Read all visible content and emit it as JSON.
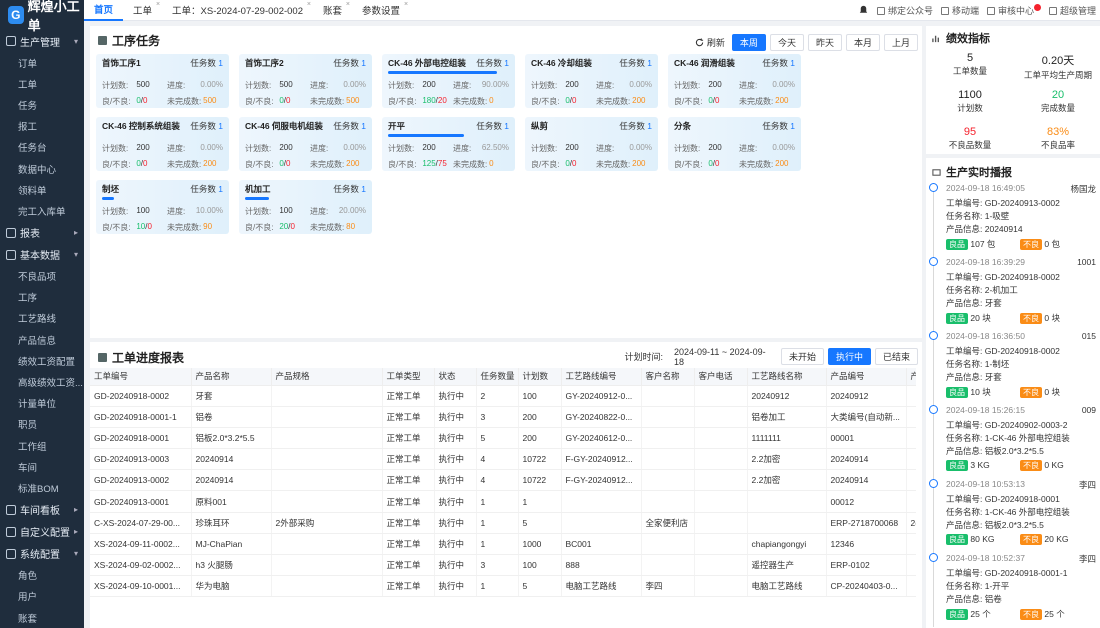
{
  "app": {
    "logo": "辉煌小工单",
    "logo_mark": "G"
  },
  "sidebar": {
    "groups": [
      {
        "label": "生产管理",
        "items": [
          "订单",
          "工单",
          "任务",
          "报工",
          "任务台",
          "数据中心",
          "领料单",
          "完工入库单"
        ]
      },
      {
        "label": "报表",
        "items": []
      },
      {
        "label": "基本数据",
        "items": [
          "不良品项",
          "工序",
          "工艺路线",
          "产品信息",
          "绩效工资配置",
          "高级绩效工资...",
          "计量单位",
          "职员",
          "工作组",
          "车间",
          "标准BOM"
        ]
      },
      {
        "label": "车间看板",
        "items": []
      },
      {
        "label": "自定义配置",
        "items": []
      },
      {
        "label": "系统配置",
        "items": [
          "角色",
          "用户",
          "账套"
        ]
      }
    ]
  },
  "tabs": [
    {
      "label": "首页",
      "active": true
    },
    {
      "label": "工单"
    },
    {
      "label": "工单：XS-2024-07-29-002-002"
    },
    {
      "label": "账套"
    },
    {
      "label": "参数设置"
    }
  ],
  "topright": [
    "绑定公众号",
    "移动端",
    "审核中心",
    "超级管理"
  ],
  "process": {
    "title": "工序任务",
    "refresh": "刷新",
    "filters": [
      "本周",
      "今天",
      "昨天",
      "本月",
      "上月"
    ],
    "labels": {
      "task": "任务数",
      "plan": "计划数:",
      "progress": "进度:",
      "good_bad": "良/不良:",
      "unfinished": "未完成数:"
    },
    "cards": [
      {
        "name": "首饰工序1",
        "tasks": "1",
        "plan": "500",
        "progress": "0.00%",
        "good": "0",
        "bad": "0",
        "unfinished": "500",
        "bar": 0
      },
      {
        "name": "首饰工序2",
        "tasks": "1",
        "plan": "500",
        "progress": "0.00%",
        "good": "0",
        "bad": "0",
        "unfinished": "500",
        "bar": 0
      },
      {
        "name": "CK-46 外部电控组装",
        "tasks": "1",
        "plan": "200",
        "progress": "90.00%",
        "good": "180",
        "bad": "20",
        "unfinished": "0",
        "bar": 0.9
      },
      {
        "name": "CK-46 冷却组装",
        "tasks": "1",
        "plan": "200",
        "progress": "0.00%",
        "good": "0",
        "bad": "0",
        "unfinished": "200",
        "bar": 0
      },
      {
        "name": "CK-46 润滑组装",
        "tasks": "1",
        "plan": "200",
        "progress": "0.00%",
        "good": "0",
        "bad": "0",
        "unfinished": "200",
        "bar": 0
      },
      {
        "name": "CK-46 控制系统组装",
        "tasks": "1",
        "plan": "200",
        "progress": "0.00%",
        "good": "0",
        "bad": "0",
        "unfinished": "200",
        "bar": 0
      },
      {
        "name": "CK-46 伺服电机组装",
        "tasks": "1",
        "plan": "200",
        "progress": "0.00%",
        "good": "0",
        "bad": "0",
        "unfinished": "200",
        "bar": 0
      },
      {
        "name": "开平",
        "tasks": "1",
        "plan": "200",
        "progress": "62.50%",
        "good": "125",
        "bad": "75",
        "unfinished": "0",
        "bar": 0.625
      },
      {
        "name": "纵剪",
        "tasks": "1",
        "plan": "200",
        "progress": "0.00%",
        "good": "0",
        "bad": "0",
        "unfinished": "200",
        "bar": 0
      },
      {
        "name": "分条",
        "tasks": "1",
        "plan": "200",
        "progress": "0.00%",
        "good": "0",
        "bad": "0",
        "unfinished": "200",
        "bar": 0
      },
      {
        "name": "制坯",
        "tasks": "1",
        "plan": "100",
        "progress": "10.00%",
        "good": "10",
        "bad": "0",
        "unfinished": "90",
        "bar": 0.1
      },
      {
        "name": "机加工",
        "tasks": "1",
        "plan": "100",
        "progress": "20.00%",
        "good": "20",
        "bad": "0",
        "unfinished": "80",
        "bar": 0.2
      }
    ]
  },
  "report": {
    "title": "工单进度报表",
    "date_label": "计划时间:",
    "date_range": "2024-09-11 ~ 2024-09-18",
    "status_buttons": [
      "未开始",
      "执行中",
      "已结束"
    ],
    "columns": [
      "工单编号",
      "产品名称",
      "产品规格",
      "工单类型",
      "状态",
      "任务数量",
      "计划数",
      "工艺路线编号",
      "客户名称",
      "客户电话",
      "工艺路线名称",
      "产品编号",
      "产"
    ],
    "rows": [
      [
        "GD-20240918-0002",
        "牙套",
        "",
        "正常工单",
        "执行中",
        "2",
        "100",
        "GY-20240912-0...",
        "",
        "",
        "20240912",
        "20240912",
        ""
      ],
      [
        "GD-20240918-0001-1",
        "铝卷",
        "",
        "正常工单",
        "执行中",
        "3",
        "200",
        "GY-20240822-0...",
        "",
        "",
        "铝卷加工",
        "大类编号(自动新...",
        ""
      ],
      [
        "GD-20240918-0001",
        "铝板2.0*3.2*5.5",
        "",
        "正常工单",
        "执行中",
        "5",
        "200",
        "GY-20240612-0...",
        "",
        "",
        "1111111",
        "00001",
        ""
      ],
      [
        "GD-20240913-0003",
        "20240914",
        "",
        "正常工单",
        "执行中",
        "4",
        "10722",
        "F-GY-20240912...",
        "",
        "",
        "2.2加密",
        "20240914",
        ""
      ],
      [
        "GD-20240913-0002",
        "20240914",
        "",
        "正常工单",
        "执行中",
        "4",
        "10722",
        "F-GY-20240912...",
        "",
        "",
        "2.2加密",
        "20240914",
        ""
      ],
      [
        "GD-20240913-0001",
        "原料001",
        "",
        "正常工单",
        "执行中",
        "1",
        "1",
        "",
        "",
        "",
        "",
        "00012",
        ""
      ],
      [
        "C-XS-2024-07-29-00...",
        "珍珠耳环",
        "2外部采购",
        "正常工单",
        "执行中",
        "1",
        "5",
        "",
        "全家便利店",
        "",
        "",
        "ERP-2718700068",
        "2("
      ],
      [
        "XS-2024-09-11-0002...",
        "MJ-ChaPian",
        "",
        "正常工单",
        "执行中",
        "1",
        "1000",
        "BC001",
        "",
        "",
        "chapiangongyi",
        "12346",
        ""
      ],
      [
        "XS-2024-09-02-0002...",
        "h3 火腿肠",
        "",
        "正常工单",
        "执行中",
        "3",
        "100",
        "888",
        "",
        "",
        "遥控器生产",
        "ERP-0102",
        ""
      ],
      [
        "XS-2024-09-10-0001...",
        "华为电脑",
        "",
        "正常工单",
        "执行中",
        "1",
        "5",
        "电脑工艺路线",
        "李四",
        "",
        "电脑工艺路线",
        "CP-20240403-0...",
        ""
      ]
    ]
  },
  "metrics": {
    "title": "绩效指标",
    "items": [
      {
        "value": "5",
        "label": "工单数量",
        "color": "#222"
      },
      {
        "value": "0.20天",
        "label": "工单平均生产周期",
        "color": "#222"
      },
      {
        "value": "1100",
        "label": "计划数",
        "color": "#222"
      },
      {
        "value": "20",
        "label": "完成数量",
        "color": "#19be6b"
      },
      {
        "value": "95",
        "label": "不良品数量",
        "color": "#f5222d"
      },
      {
        "value": "83%",
        "label": "不良品率",
        "color": "#fa8c16"
      }
    ]
  },
  "feed": {
    "title": "生产实时播报",
    "labels": {
      "code": "工单编号:",
      "task": "任务名称:",
      "product": "产品信息:",
      "good": "良品",
      "bad": "不良"
    },
    "items": [
      {
        "time": "2024-09-18 16:49:05",
        "user": "杨国龙",
        "code": "GD-20240913-0002",
        "task": "1-吸壁",
        "product": "20240914",
        "good": "107 包",
        "bad": "0 包"
      },
      {
        "time": "2024-09-18 16:39:29",
        "user": "1001",
        "code": "GD-20240918-0002",
        "task": "2-机加工",
        "product": "牙套",
        "good": "20 块",
        "bad": "0 块"
      },
      {
        "time": "2024-09-18 16:36:50",
        "user": "015",
        "code": "GD-20240918-0002",
        "task": "1-制坯",
        "product": "牙套",
        "good": "10 块",
        "bad": "0 块"
      },
      {
        "time": "2024-09-18 15:26:15",
        "user": "009",
        "code": "GD-20240902-0003-2",
        "task": "1-CK-46 外部电控组装",
        "product": "铝板2.0*3.2*5.5",
        "good": "3 KG",
        "bad": "0 KG"
      },
      {
        "time": "2024-09-18 10:53:13",
        "user": "李四",
        "code": "GD-20240918-0001",
        "task": "1-CK-46 外部电控组装",
        "product": "铝板2.0*3.2*5.5",
        "good": "80 KG",
        "bad": "20 KG"
      },
      {
        "time": "2024-09-18 10:52:37",
        "user": "李四",
        "code": "GD-20240918-0001-1",
        "task": "1-开平",
        "product": "铝卷",
        "good": "25 个",
        "bad": "25 个"
      }
    ]
  }
}
